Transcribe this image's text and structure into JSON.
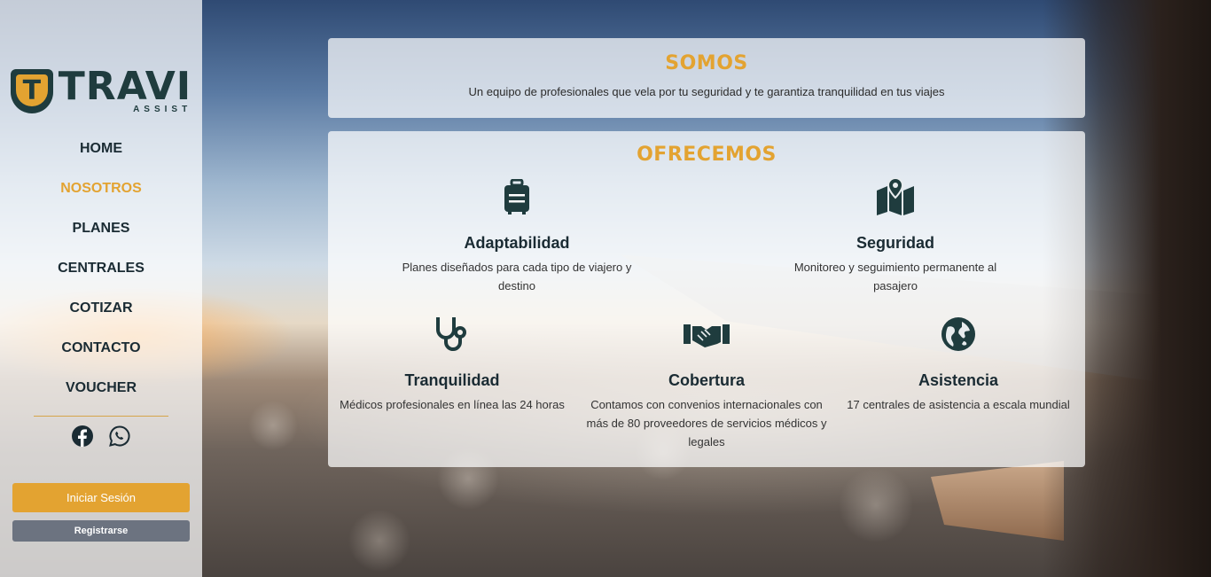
{
  "brand": {
    "name": "TRAVI",
    "sub": "ASSIST",
    "mark": "T"
  },
  "nav": {
    "items": [
      {
        "label": "HOME"
      },
      {
        "label": "NOSOTROS",
        "active": true
      },
      {
        "label": "PLANES"
      },
      {
        "label": "CENTRALES"
      },
      {
        "label": "COTIZAR"
      },
      {
        "label": "CONTACTO"
      },
      {
        "label": "VOUCHER"
      }
    ]
  },
  "social": [
    {
      "icon": "facebook-icon"
    },
    {
      "icon": "whatsapp-icon"
    }
  ],
  "auth": {
    "login_label": "Iniciar Sesión",
    "register_label": "Registrarse"
  },
  "colors": {
    "accent": "#e3a331",
    "dark": "#1f3c3e",
    "text": "#1a2b33",
    "register": "#6c7380"
  },
  "somos": {
    "title": "SOMOS",
    "description": "Un equipo de profesionales que vela por tu seguridad y te garantiza tranquilidad en tus viajes"
  },
  "ofrecemos": {
    "title": "OFRECEMOS",
    "features": [
      {
        "icon": "suitcase-icon",
        "title": "Adaptabilidad",
        "description": "Planes diseñados para cada tipo de viajero y destino"
      },
      {
        "icon": "map-pin-icon",
        "title": "Seguridad",
        "description": "Monitoreo y seguimiento permanente al pasajero"
      },
      {
        "icon": "stethoscope-icon",
        "title": "Tranquilidad",
        "description": "Médicos profesionales en línea las 24 horas"
      },
      {
        "icon": "handshake-icon",
        "title": "Cobertura",
        "description": "Contamos con convenios internacionales con más de 80 proveedores de servicios médicos y legales"
      },
      {
        "icon": "globe-icon",
        "title": "Asistencia",
        "description": "17 centrales de asistencia a escala mundial"
      }
    ]
  }
}
